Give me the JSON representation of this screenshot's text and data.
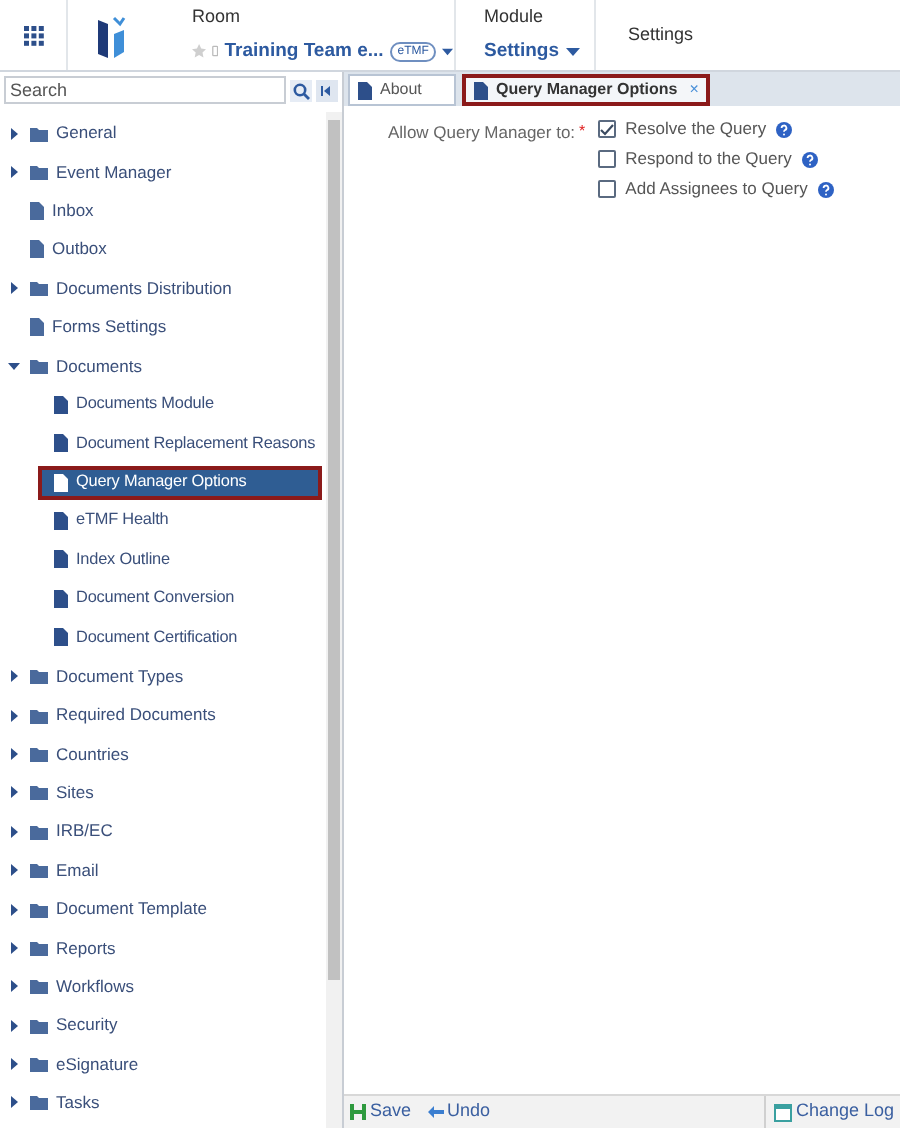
{
  "header": {
    "room_label": "Room",
    "room_name": "Training Team e...",
    "room_badge": "eTMF",
    "module_label": "Module",
    "module_name": "Settings",
    "breadcrumb": "Settings"
  },
  "sidebar": {
    "search_placeholder": "Search",
    "items": [
      {
        "label": "General",
        "expandable": true,
        "expanded": false,
        "selected": false
      },
      {
        "label": "Event Manager",
        "expandable": true,
        "expanded": false,
        "selected": false
      },
      {
        "label": "Inbox",
        "expandable": false,
        "selected": false
      },
      {
        "label": "Outbox",
        "expandable": false,
        "selected": false
      },
      {
        "label": "Documents Distribution",
        "expandable": true,
        "expanded": false,
        "selected": false
      },
      {
        "label": "Forms Settings",
        "expandable": false,
        "selected": false
      },
      {
        "label": "Documents",
        "expandable": true,
        "expanded": true,
        "selected": false,
        "children": [
          {
            "label": "Documents Module",
            "selected": false
          },
          {
            "label": "Document Replacement Reasons",
            "selected": false
          },
          {
            "label": "Query Manager Options",
            "selected": true
          },
          {
            "label": "eTMF Health",
            "selected": false
          },
          {
            "label": "Index Outline",
            "selected": false
          },
          {
            "label": "Document Conversion",
            "selected": false
          },
          {
            "label": "Document Certification",
            "selected": false
          }
        ]
      },
      {
        "label": "Document Types",
        "expandable": true,
        "expanded": false,
        "selected": false
      },
      {
        "label": "Required Documents",
        "expandable": true,
        "expanded": false,
        "selected": false
      },
      {
        "label": "Countries",
        "expandable": true,
        "expanded": false,
        "selected": false
      },
      {
        "label": "Sites",
        "expandable": true,
        "expanded": false,
        "selected": false
      },
      {
        "label": "IRB/EC",
        "expandable": true,
        "expanded": false,
        "selected": false
      },
      {
        "label": "Email",
        "expandable": true,
        "expanded": false,
        "selected": false
      },
      {
        "label": "Document Template",
        "expandable": true,
        "expanded": false,
        "selected": false
      },
      {
        "label": "Reports",
        "expandable": true,
        "expanded": false,
        "selected": false
      },
      {
        "label": "Workflows",
        "expandable": true,
        "expanded": false,
        "selected": false
      },
      {
        "label": "Security",
        "expandable": true,
        "expanded": false,
        "selected": false
      },
      {
        "label": "eSignature",
        "expandable": true,
        "expanded": false,
        "selected": false
      },
      {
        "label": "Tasks",
        "expandable": true,
        "expanded": false,
        "selected": false
      }
    ]
  },
  "tabs": [
    {
      "label": "About",
      "selected": false
    },
    {
      "label": "Query Manager Options",
      "selected": true,
      "close": "×"
    }
  ],
  "form": {
    "label": "Allow Query Manager to:",
    "required_mark": "*",
    "options": [
      {
        "label": "Resolve the Query",
        "checked": true
      },
      {
        "label": "Respond to the Query",
        "checked": false
      },
      {
        "label": "Add Assignees to Query",
        "checked": false
      }
    ]
  },
  "footer": {
    "save": "Save",
    "undo": "Undo",
    "change_log": "Change Log"
  }
}
